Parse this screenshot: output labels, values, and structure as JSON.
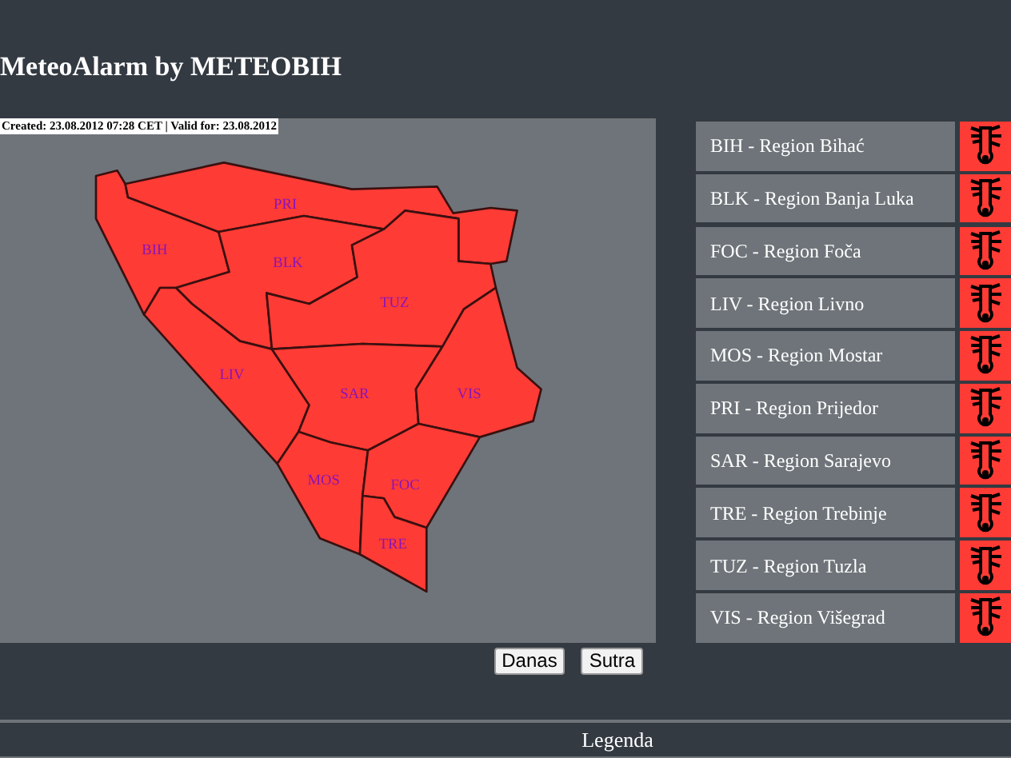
{
  "header": {
    "title": "MeteoAlarm by METEOBIH"
  },
  "map": {
    "info": "Created: 23.08.2012 07:28 CET | Valid for: 23.08.2012",
    "regions": [
      {
        "code": "BIH",
        "color": "#ff3b35"
      },
      {
        "code": "PRI",
        "color": "#ff3b35"
      },
      {
        "code": "BLK",
        "color": "#ff3b35"
      },
      {
        "code": "LIV",
        "color": "#ff3b35"
      },
      {
        "code": "TUZ",
        "color": "#ff3b35"
      },
      {
        "code": "SAR",
        "color": "#ff3b35"
      },
      {
        "code": "VIS",
        "color": "#ff3b35"
      },
      {
        "code": "MOS",
        "color": "#ff3b35"
      },
      {
        "code": "FOC",
        "color": "#ff3b35"
      },
      {
        "code": "TRE",
        "color": "#ff3b35"
      }
    ]
  },
  "regions_list": [
    {
      "label": "BIH - Region Bihać",
      "color": "#ff3b35"
    },
    {
      "label": "BLK - Region Banja Luka",
      "color": "#ff3b35"
    },
    {
      "label": "FOC - Region Foča",
      "color": "#ff3b35"
    },
    {
      "label": "LIV - Region Livno",
      "color": "#ff3b35"
    },
    {
      "label": "MOS - Region Mostar",
      "color": "#ff3b35"
    },
    {
      "label": "PRI - Region Prijedor",
      "color": "#ff3b35"
    },
    {
      "label": "SAR - Region Sarajevo",
      "color": "#ff3b35"
    },
    {
      "label": "TRE - Region Trebinje",
      "color": "#ff3b35"
    },
    {
      "label": "TUZ - Region Tuzla",
      "color": "#ff3b35"
    },
    {
      "label": "VIS - Region Višegrad",
      "color": "#ff3b35"
    }
  ],
  "day_buttons": [
    "Danas",
    "Sutra"
  ],
  "footer": {
    "legend": "Legenda"
  }
}
